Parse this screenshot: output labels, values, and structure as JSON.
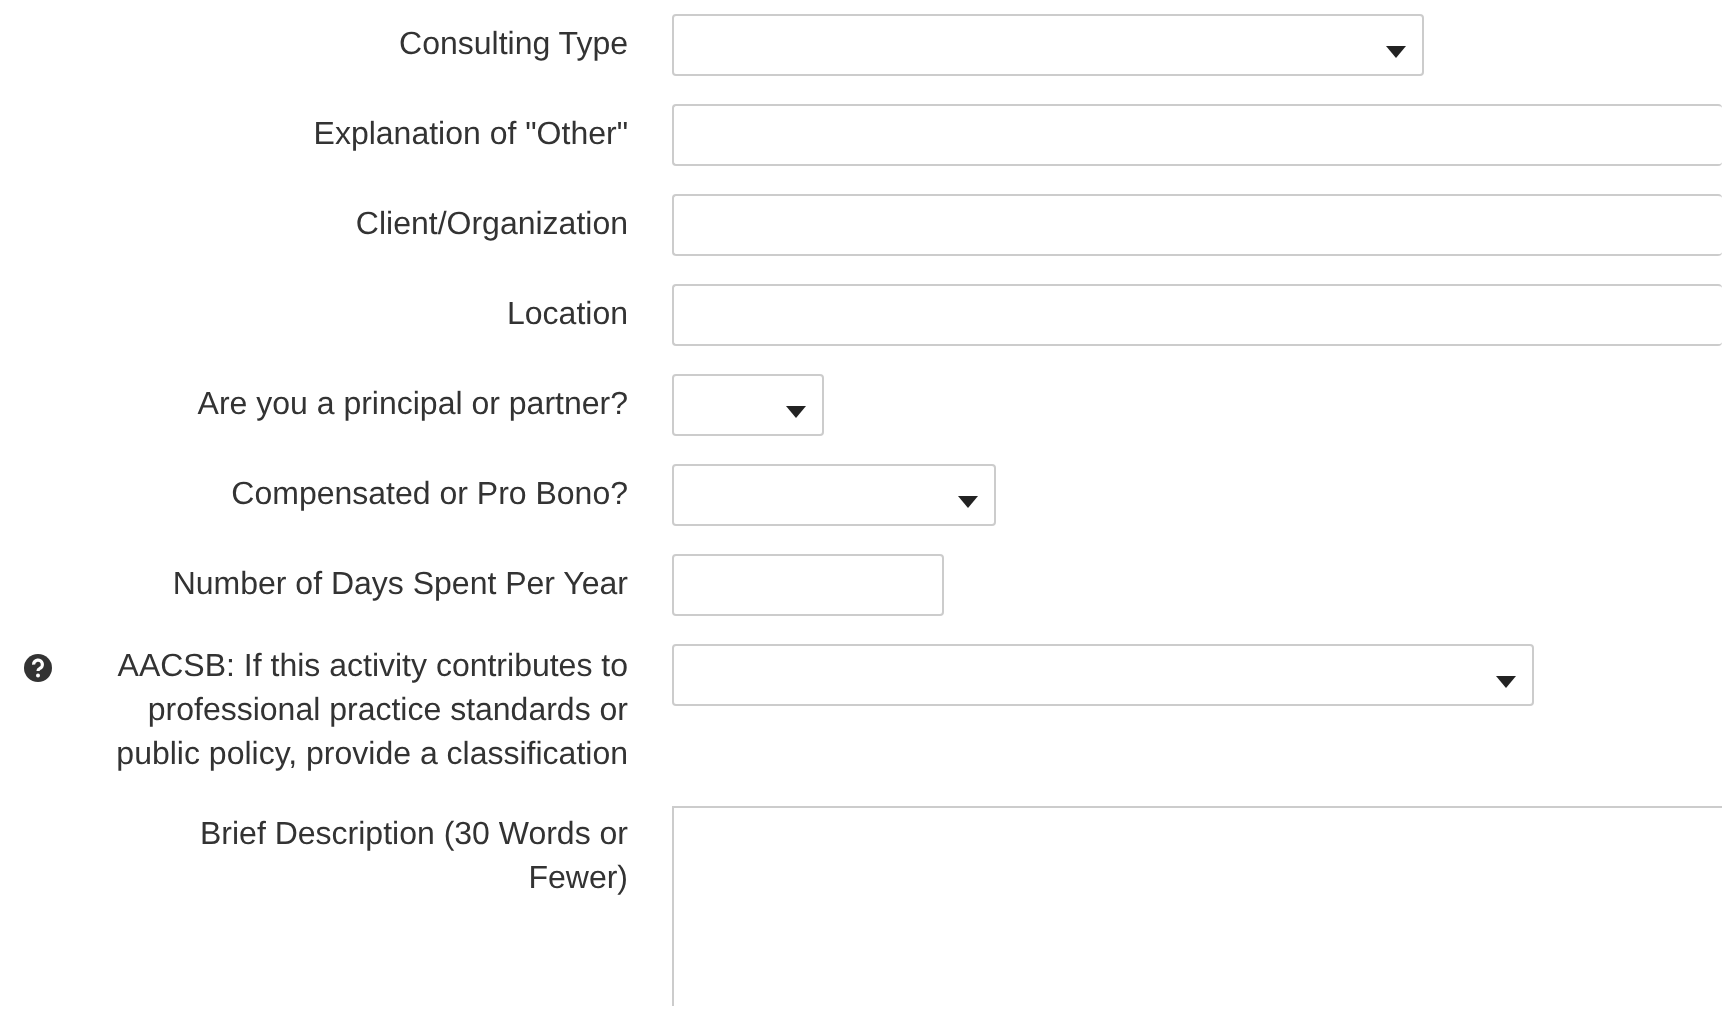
{
  "fields": [
    {
      "label": "Consulting Type",
      "kind": "select"
    },
    {
      "label": "Explanation of \"Other\"",
      "kind": "text"
    },
    {
      "label": "Client/Organization",
      "kind": "text"
    },
    {
      "label": "Location",
      "kind": "text"
    },
    {
      "label": "Are you a principal or partner?",
      "kind": "select"
    },
    {
      "label": "Compensated or Pro Bono?",
      "kind": "select"
    },
    {
      "label": "Number of Days Spent Per Year",
      "kind": "text"
    },
    {
      "label": "AACSB: If this activity contributes to professional practice standards or public policy, provide a classification",
      "kind": "select",
      "help_icon": true
    },
    {
      "label": "Brief Description (30 Words or Fewer)",
      "kind": "textarea"
    }
  ]
}
